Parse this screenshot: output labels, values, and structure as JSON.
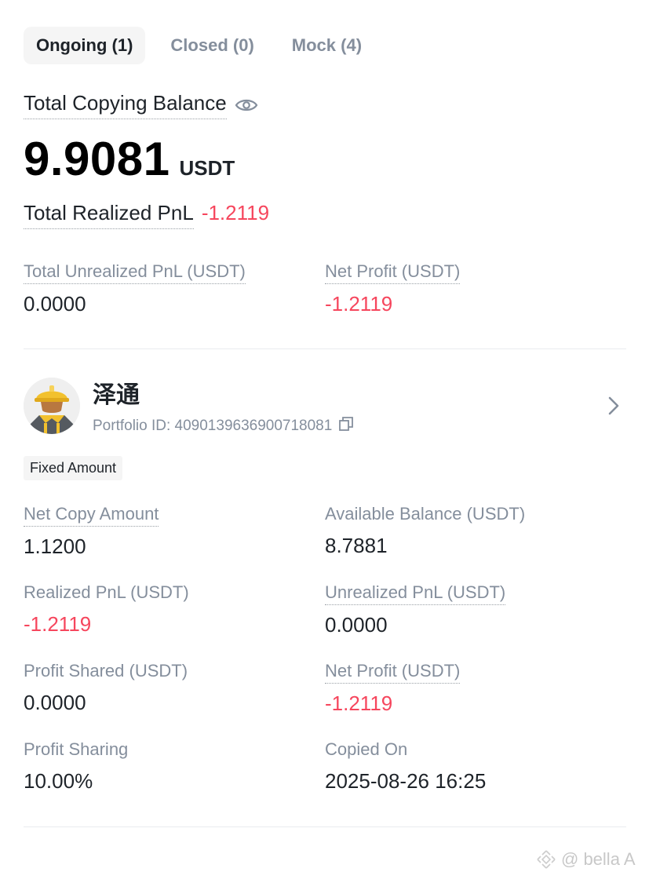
{
  "tabs": [
    {
      "label": "Ongoing (1)",
      "active": true
    },
    {
      "label": "Closed (0)",
      "active": false
    },
    {
      "label": "Mock (4)",
      "active": false
    }
  ],
  "summary": {
    "balance_label": "Total Copying Balance",
    "balance_value": "9.9081",
    "balance_unit": "USDT",
    "realized_label": "Total Realized PnL",
    "realized_value": "-1.2119",
    "unrealized_label": "Total Unrealized PnL (USDT)",
    "unrealized_value": "0.0000",
    "net_profit_label": "Net Profit (USDT)",
    "net_profit_value": "-1.2119"
  },
  "trader": {
    "name": "泽通",
    "portfolio_id": "Portfolio ID: 4090139636900718081",
    "tag": "Fixed Amount",
    "stats": {
      "net_copy_amount_label": "Net Copy Amount",
      "net_copy_amount_value": "1.1200",
      "available_balance_label": "Available Balance (USDT)",
      "available_balance_value": "8.7881",
      "realized_pnl_label": "Realized PnL (USDT)",
      "realized_pnl_value": "-1.2119",
      "unrealized_pnl_label": "Unrealized PnL (USDT)",
      "unrealized_pnl_value": "0.0000",
      "profit_shared_label": "Profit Shared (USDT)",
      "profit_shared_value": "0.0000",
      "net_profit_label": "Net Profit (USDT)",
      "net_profit_value": "-1.2119",
      "profit_sharing_label": "Profit Sharing",
      "profit_sharing_value": "10.00%",
      "copied_on_label": "Copied On",
      "copied_on_value": "2025-08-26 16:25"
    }
  },
  "watermark": "@ bella A",
  "colors": {
    "negative": "#f6465d",
    "muted": "#848e9c",
    "text": "#1e2329"
  },
  "icons": [
    "eye-icon",
    "copy-icon",
    "chevron-right-icon",
    "binance-logo-icon"
  ]
}
